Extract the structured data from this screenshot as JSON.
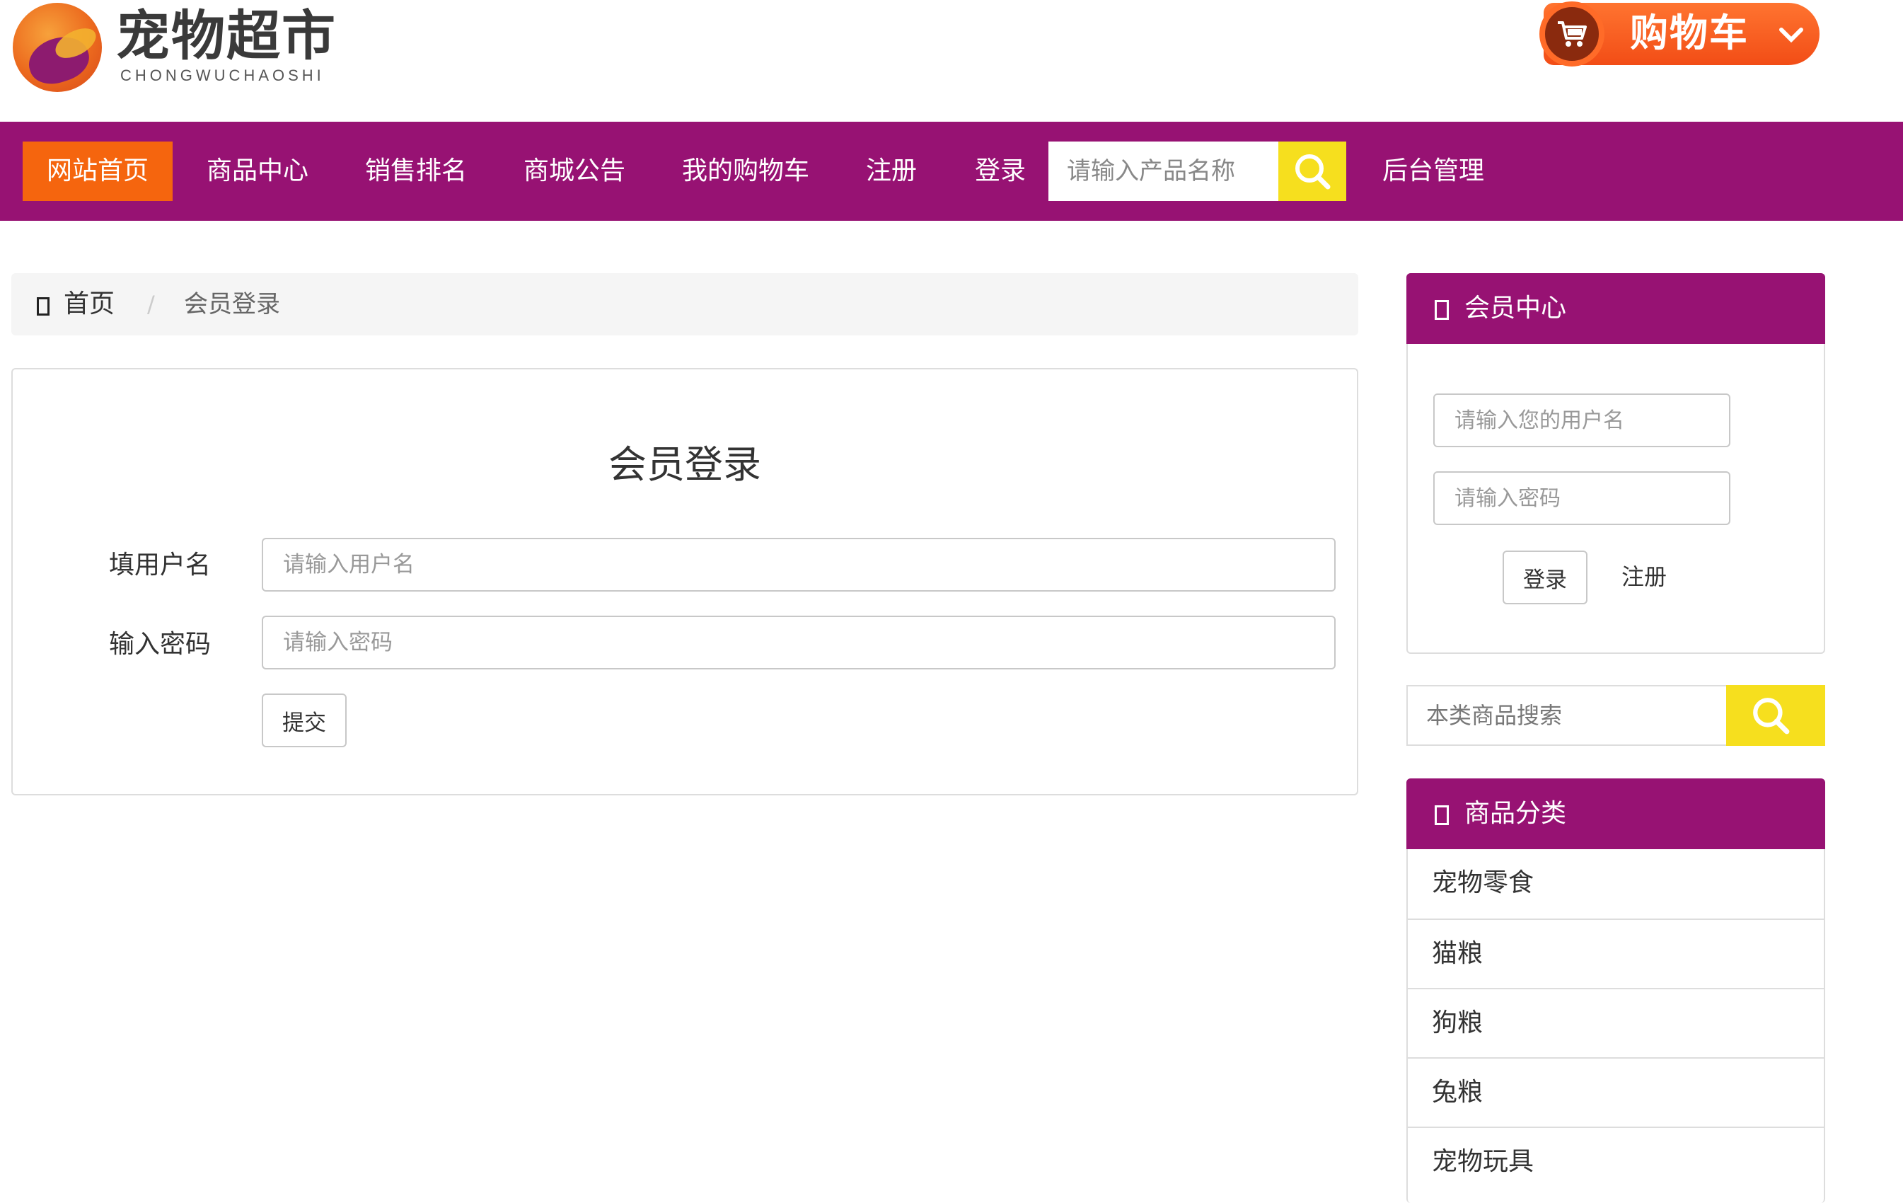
{
  "logo": {
    "title": "宠物超市",
    "subtitle": "CHONGWUCHAOSHI"
  },
  "cart": {
    "label": "购物车",
    "icon": "shopping-cart-icon"
  },
  "nav": {
    "items": [
      {
        "label": "网站首页",
        "active": true
      },
      {
        "label": "商品中心"
      },
      {
        "label": "销售排名"
      },
      {
        "label": "商城公告"
      },
      {
        "label": "我的购物车"
      },
      {
        "label": "注册"
      },
      {
        "label": "登录"
      }
    ],
    "search_placeholder": "请输入产品名称",
    "admin_label": "后台管理"
  },
  "breadcrumb": {
    "home": "首页",
    "separator": "/",
    "current": "会员登录"
  },
  "login_form": {
    "title": "会员登录",
    "username_label": "填用户名",
    "username_placeholder": "请输入用户名",
    "password_label": "输入密码",
    "password_placeholder": "请输入密码",
    "submit_label": "提交"
  },
  "member_center": {
    "title": "会员中心",
    "username_placeholder": "请输入您的用户名",
    "password_placeholder": "请输入密码",
    "login_label": "登录",
    "register_label": "注册"
  },
  "category_search": {
    "placeholder": "本类商品搜索"
  },
  "categories": {
    "title": "商品分类",
    "items": [
      "宠物零食",
      "猫粮",
      "狗粮",
      "兔粮",
      "宠物玩具"
    ]
  },
  "colors": {
    "brand_purple": "#971273",
    "accent_orange": "#f5650e",
    "search_yellow": "#f6df1e"
  }
}
